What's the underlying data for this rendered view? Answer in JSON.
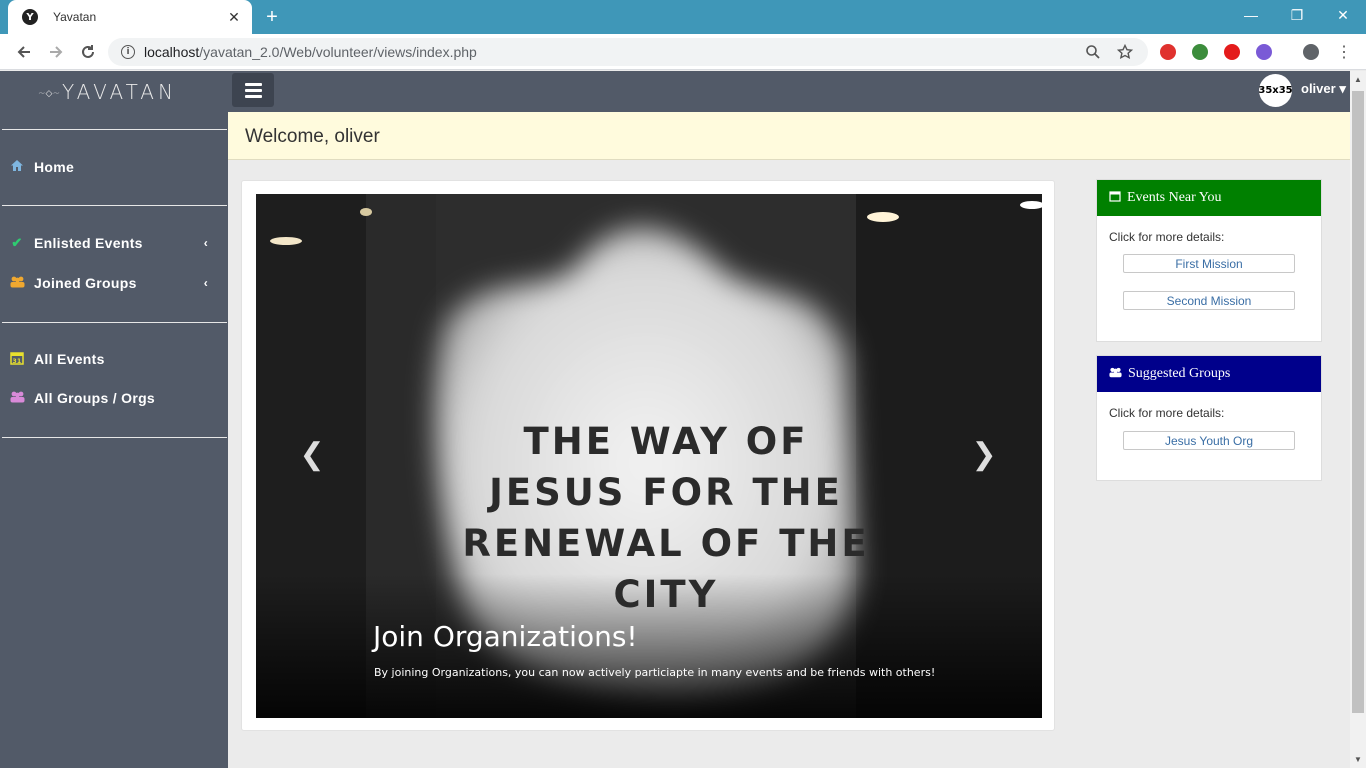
{
  "browser": {
    "tab_title": "Yavatan",
    "favicon_letter": "Y",
    "tab_close": "✕",
    "new_tab": "+",
    "url_host": "localhost",
    "url_path": "/yavatan_2.0/Web/volunteer/views/index.php",
    "controls": {
      "minimize": "—",
      "restore": "❐",
      "close": "✕"
    }
  },
  "sidebar": {
    "brand": "YAVATAN",
    "items": [
      {
        "label": "Home",
        "icon": "home-icon",
        "glyph": "⌂"
      },
      {
        "label": "Enlisted Events",
        "icon": "check-icon",
        "glyph": "✔",
        "caret": "‹"
      },
      {
        "label": "Joined Groups",
        "icon": "group-icon",
        "glyph": "👥",
        "caret": "‹"
      },
      {
        "label": "All Events",
        "icon": "calendar-icon",
        "glyph": "▦"
      },
      {
        "label": "All Groups / Orgs",
        "icon": "group-icon",
        "glyph": "👥"
      }
    ]
  },
  "topbar": {
    "avatar_text": "35x35",
    "user": "oliver",
    "user_caret": "▾"
  },
  "welcome": {
    "text": "Welcome, oliver"
  },
  "carousel": {
    "sign_text": "THE WAY OF JESUS FOR THE RENEWAL OF THE CITY",
    "caption_title": "Join Organizations!",
    "caption_text": "By joining Organizations, you can now actively particiapte in many events and be friends with others!",
    "prev": "❮",
    "next": "❯"
  },
  "events_card": {
    "title": "Events Near You",
    "note": "Click for more details:",
    "items": [
      "First Mission",
      "Second Mission"
    ],
    "header_color": "#008000"
  },
  "groups_card": {
    "title": "Suggested Groups",
    "note": "Click for more details:",
    "items": [
      "Jesus Youth Org"
    ],
    "header_color": "#00008b"
  },
  "colors": {
    "sidebar": "#525a68",
    "welcome_bg": "#fffbdd",
    "browser_frame": "#3f97b8"
  }
}
